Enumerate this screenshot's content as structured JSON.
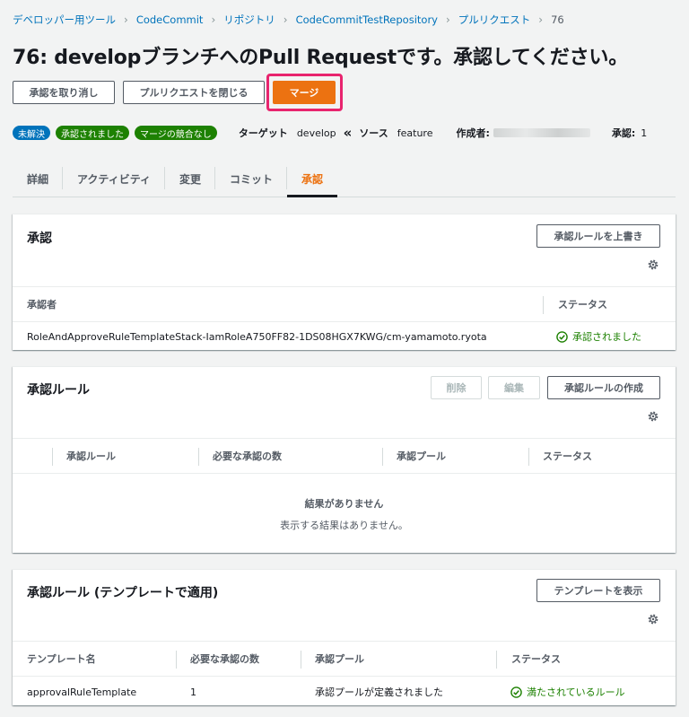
{
  "breadcrumb": {
    "items": [
      "デベロッパー用ツール",
      "CodeCommit",
      "リポジトリ",
      "CodeCommitTestRepository",
      "プルリクエスト"
    ],
    "current": "76"
  },
  "page": {
    "title": "76: developブランチへのPull Requestです。承認してください。"
  },
  "actions": {
    "revoke": "承認を取り消し",
    "close": "プルリクエストを閉じる",
    "merge": "マージ"
  },
  "meta": {
    "badges": [
      "未解決",
      "承認されました",
      "マージの競合なし"
    ],
    "target_label": "ターゲット",
    "target_value": "develop",
    "arrow": "«",
    "source_label": "ソース",
    "source_value": "feature",
    "author_label": "作成者:",
    "approvals_label": "承認:",
    "approvals_value": "1"
  },
  "tabs": [
    "詳細",
    "アクティビティ",
    "変更",
    "コミット",
    "承認"
  ],
  "approvals_panel": {
    "title": "承認",
    "override_button": "承認ルールを上書き",
    "columns": [
      "承認者",
      "ステータス"
    ],
    "rows": [
      {
        "approver": "RoleAndApproveRuleTemplateStack-IamRoleA750FF82-1DS08HGX7KWG/cm-yamamoto.ryota",
        "status": "承認されました"
      }
    ]
  },
  "rules_panel": {
    "title": "承認ルール",
    "delete_button": "削除",
    "edit_button": "編集",
    "create_button": "承認ルールの作成",
    "columns": [
      "承認ルール",
      "必要な承認の数",
      "承認プール",
      "ステータス"
    ],
    "empty_title": "結果がありません",
    "empty_text": "表示する結果はありません。"
  },
  "template_panel": {
    "title": "承認ルール (テンプレートで適用)",
    "show_button": "テンプレートを表示",
    "columns": [
      "テンプレート名",
      "必要な承認の数",
      "承認プール",
      "ステータス"
    ],
    "rows": [
      {
        "name": "approvalRuleTemplate",
        "count": "1",
        "pool": "承認プールが定義されました",
        "status": "満たされているルール"
      }
    ]
  },
  "colors": {
    "link": "#0073bb",
    "accent": "#ec7211",
    "success": "#1d8102",
    "highlight": "#e8246e"
  }
}
